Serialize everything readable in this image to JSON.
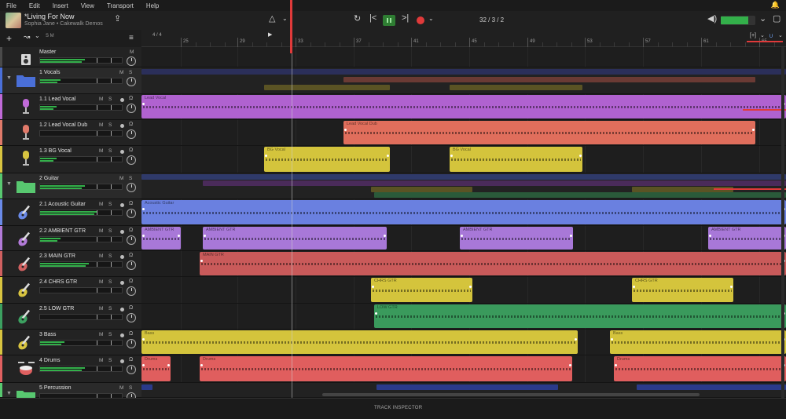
{
  "menu": [
    "File",
    "Edit",
    "Insert",
    "View",
    "Transport",
    "Help"
  ],
  "project": {
    "title": "*Living For Now",
    "subtitle": "Sophia Jane • Cakewalk Demos"
  },
  "transport": {
    "position": "32 / 3 / 2",
    "metronome_icon": "metronome-icon",
    "colors": {
      "play": "#2e7d32",
      "record": "#e03a3a"
    }
  },
  "master_volume_level": 0.8,
  "toolbar": {
    "add": "+",
    "mode": "↝",
    "mode_caret": "⌄",
    "sm": "S M",
    "filter": "≡"
  },
  "ruler": {
    "time_signature": "4 / 4",
    "bars": [
      "25",
      "29",
      "33",
      "37",
      "41",
      "45",
      "49",
      "53",
      "57",
      "61",
      "65"
    ]
  },
  "tracks": [
    {
      "id": "master",
      "name": "Master",
      "labels": [
        "M"
      ],
      "icon": "speaker-icon",
      "color": "#4a4a4a",
      "folder": false,
      "level": 0.55
    },
    {
      "id": "vocals",
      "name": "1 Vocals",
      "labels": [
        "M",
        "S"
      ],
      "icon": "folder-icon",
      "color": "#4a6fd8",
      "folder": true,
      "level": 0.25
    },
    {
      "id": "leadvocal",
      "name": "1.1 Lead Vocal",
      "labels": [
        "M",
        "S"
      ],
      "icon": "microphone-icon",
      "color": "#c06ad8",
      "folder": false,
      "level": 0.2
    },
    {
      "id": "leadvocaldub",
      "name": "1.2 Lead Vocal Dub",
      "labels": [
        "M",
        "S"
      ],
      "icon": "microphone-icon",
      "color": "#e07a6a",
      "folder": false,
      "level": 0.0
    },
    {
      "id": "bgvocal",
      "name": "1.3 BG Vocal",
      "labels": [
        "M",
        "S"
      ],
      "icon": "microphone-icon",
      "color": "#d8c440",
      "folder": false,
      "level": 0.2
    },
    {
      "id": "guitar",
      "name": "2 Guitar",
      "labels": [
        "M",
        "S"
      ],
      "icon": "folder-icon",
      "color": "#58c870",
      "folder": true,
      "level": 0.55
    },
    {
      "id": "acoustic",
      "name": "2.1 Acoustic Guitar",
      "labels": [
        "M",
        "S"
      ],
      "icon": "guitar-icon",
      "color": "#6a8ae8",
      "folder": false,
      "level": 0.7
    },
    {
      "id": "ambient",
      "name": "2.2 AMBIENT GTR",
      "labels": [
        "M",
        "S"
      ],
      "icon": "guitar-icon",
      "color": "#b27ad8",
      "folder": false,
      "level": 0.25
    },
    {
      "id": "main",
      "name": "2.3 MAIN GTR",
      "labels": [
        "M",
        "S"
      ],
      "icon": "guitar-icon",
      "color": "#d06060",
      "folder": false,
      "level": 0.6
    },
    {
      "id": "chrs",
      "name": "2.4 CHRS GTR",
      "labels": [
        "M",
        "S"
      ],
      "icon": "guitar-icon",
      "color": "#d8c440",
      "folder": false,
      "level": 0.0
    },
    {
      "id": "low",
      "name": "2.5 LOW GTR",
      "labels": [
        "M",
        "S"
      ],
      "icon": "guitar-icon",
      "color": "#3ca060",
      "folder": false,
      "level": 0.0
    },
    {
      "id": "bass",
      "name": "3 Bass",
      "labels": [
        "M",
        "S"
      ],
      "icon": "guitar-icon",
      "color": "#d8c440",
      "folder": false,
      "level": 0.3
    },
    {
      "id": "drums",
      "name": "4 Drums",
      "labels": [
        "M",
        "S"
      ],
      "icon": "drums-icon",
      "color": "#e06060",
      "folder": false,
      "level": 0.55
    },
    {
      "id": "perc",
      "name": "5 Percussion",
      "labels": [
        "M",
        "S"
      ],
      "icon": "folder-icon",
      "color": "#58c870",
      "folder": true,
      "level": 0.0
    }
  ],
  "clips": {
    "leadvocal": [
      {
        "name": "Lead Vocal",
        "start": 0,
        "end": 820,
        "color": "#b062d0"
      }
    ],
    "leadvocaldub": [
      {
        "name": "Lead Vocal Dub",
        "start": 257,
        "end": 781,
        "color": "#e06e5c"
      }
    ],
    "bgvocal": [
      {
        "name": "BG Vocal",
        "start": 156,
        "end": 316,
        "color": "#d4c43c"
      },
      {
        "name": "BG Vocal",
        "start": 392,
        "end": 561,
        "color": "#d4c43c"
      }
    ],
    "acoustic": [
      {
        "name": "Acoustic Guitar",
        "start": 0,
        "end": 820,
        "color": "#6a80e0"
      }
    ],
    "ambient": [
      {
        "name": "AMBIENT GTR",
        "start": 0,
        "end": 50,
        "color": "#a878d8"
      },
      {
        "name": "AMBIENT GTR",
        "start": 78,
        "end": 312,
        "color": "#a878d8"
      },
      {
        "name": "AMBIENT GTR",
        "start": 405,
        "end": 549,
        "color": "#a878d8"
      },
      {
        "name": "AMBIENT GTR",
        "start": 721,
        "end": 820,
        "color": "#a878d8"
      }
    ],
    "main": [
      {
        "name": "MAIN GTR",
        "start": 74,
        "end": 820,
        "color": "#c95a5a"
      }
    ],
    "chrs": [
      {
        "name": "CHRS GTR",
        "start": 292,
        "end": 421,
        "color": "#d4c43c"
      },
      {
        "name": "CHRS GTR",
        "start": 624,
        "end": 753,
        "color": "#d4c43c"
      }
    ],
    "low": [
      {
        "name": "LOW GTR",
        "start": 296,
        "end": 820,
        "color": "#3a9a5c"
      }
    ],
    "bass": [
      {
        "name": "Bass",
        "start": 0,
        "end": 555,
        "color": "#d4c43c"
      },
      {
        "name": "Bass",
        "start": 596,
        "end": 820,
        "color": "#d4c43c"
      }
    ],
    "drums": [
      {
        "name": "Drums",
        "start": 0,
        "end": 37,
        "color": "#e05e5e"
      },
      {
        "name": "Drums",
        "start": 74,
        "end": 548,
        "color": "#e05e5e"
      },
      {
        "name": "Drums",
        "start": 601,
        "end": 820,
        "color": "#e05e5e"
      }
    ]
  },
  "inspector": {
    "label": "TRACK INSPECTOR"
  }
}
